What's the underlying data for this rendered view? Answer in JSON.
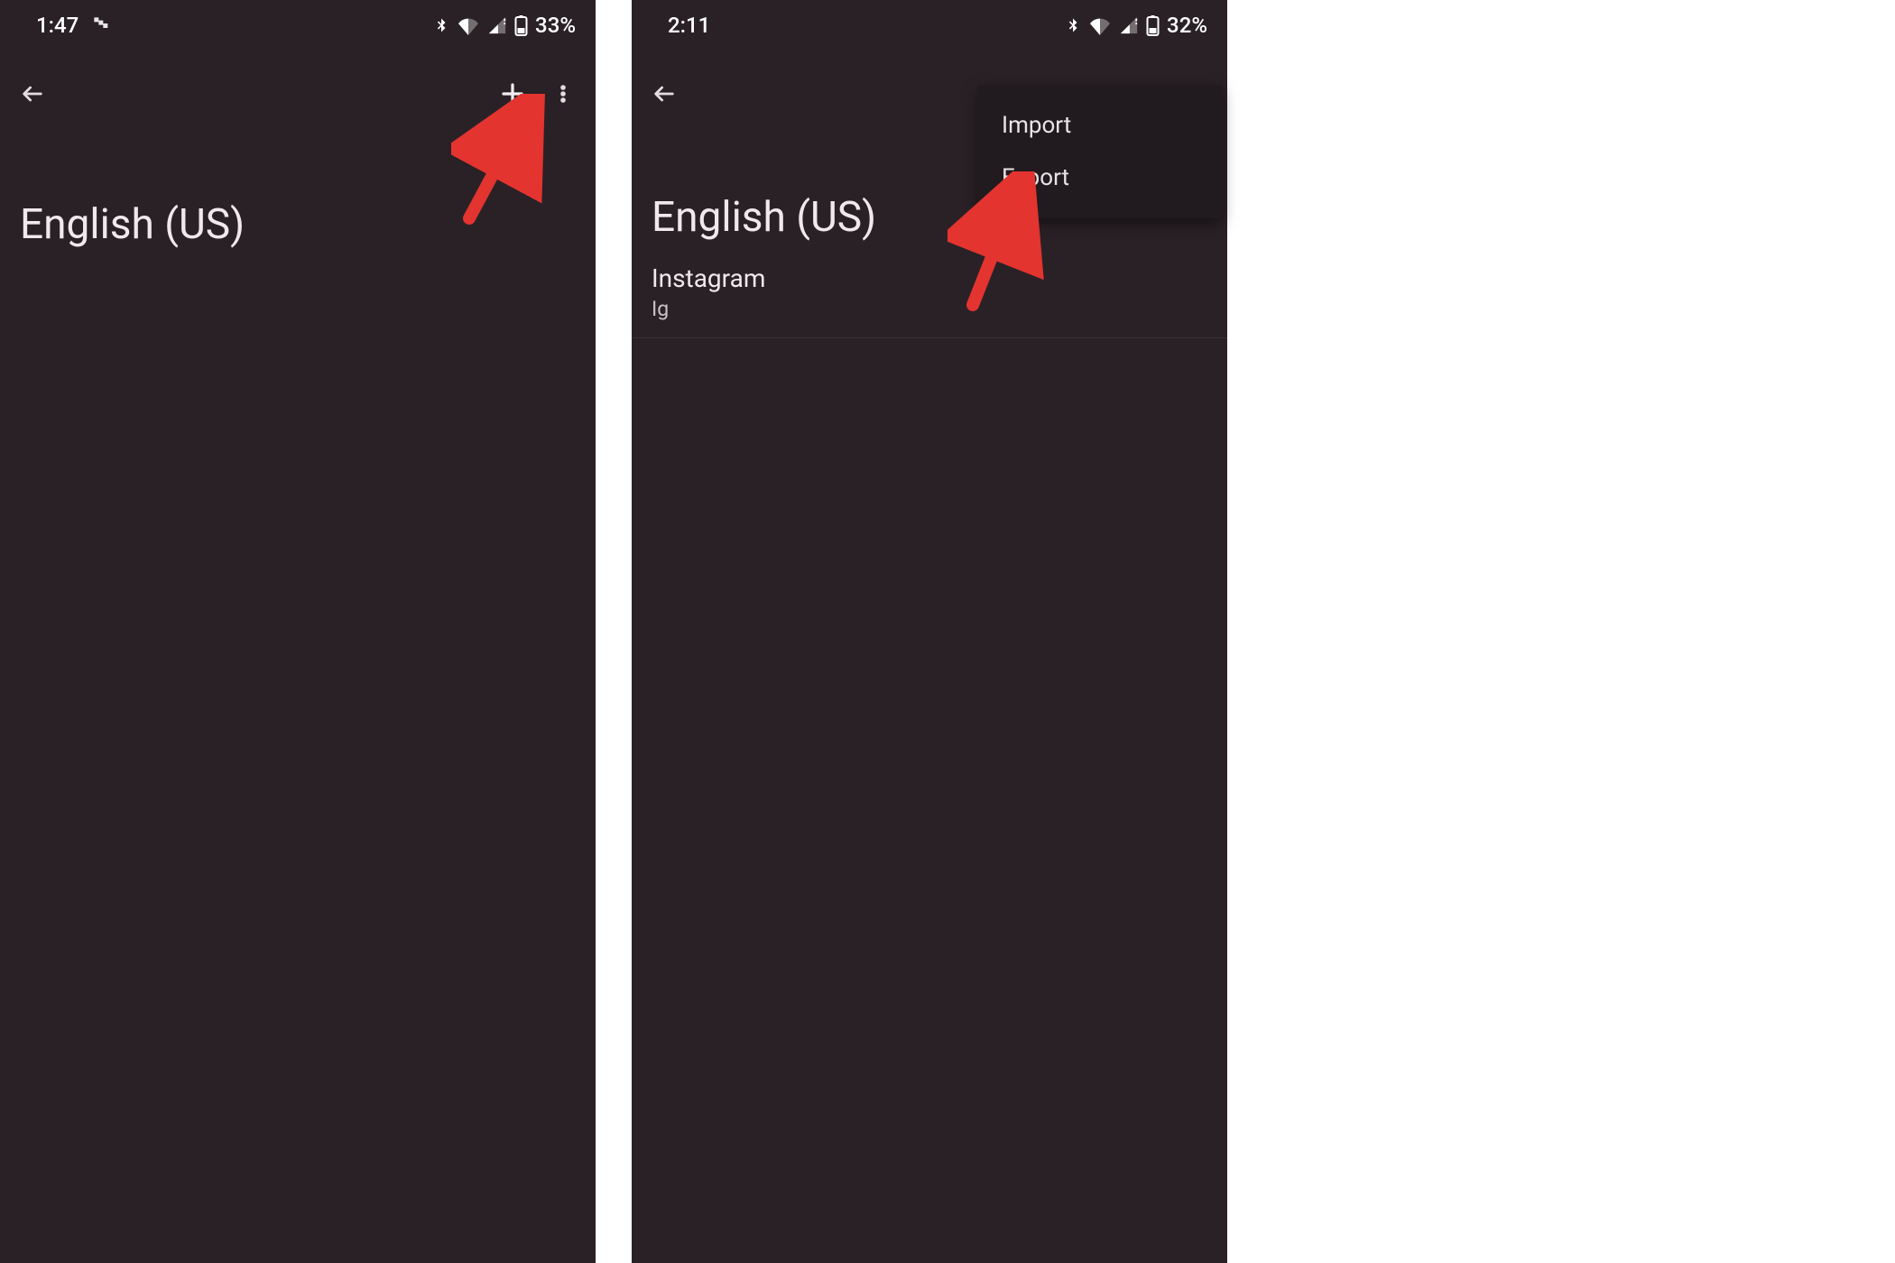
{
  "left": {
    "status": {
      "time": "1:47",
      "battery": "33%"
    },
    "title": "English (US)"
  },
  "right": {
    "status": {
      "time": "2:11",
      "battery": "32%"
    },
    "title": "English (US)",
    "menu": {
      "import": "Import",
      "export": "Export"
    },
    "entry": {
      "word": "Instagram",
      "shortcut": "Ig"
    }
  }
}
